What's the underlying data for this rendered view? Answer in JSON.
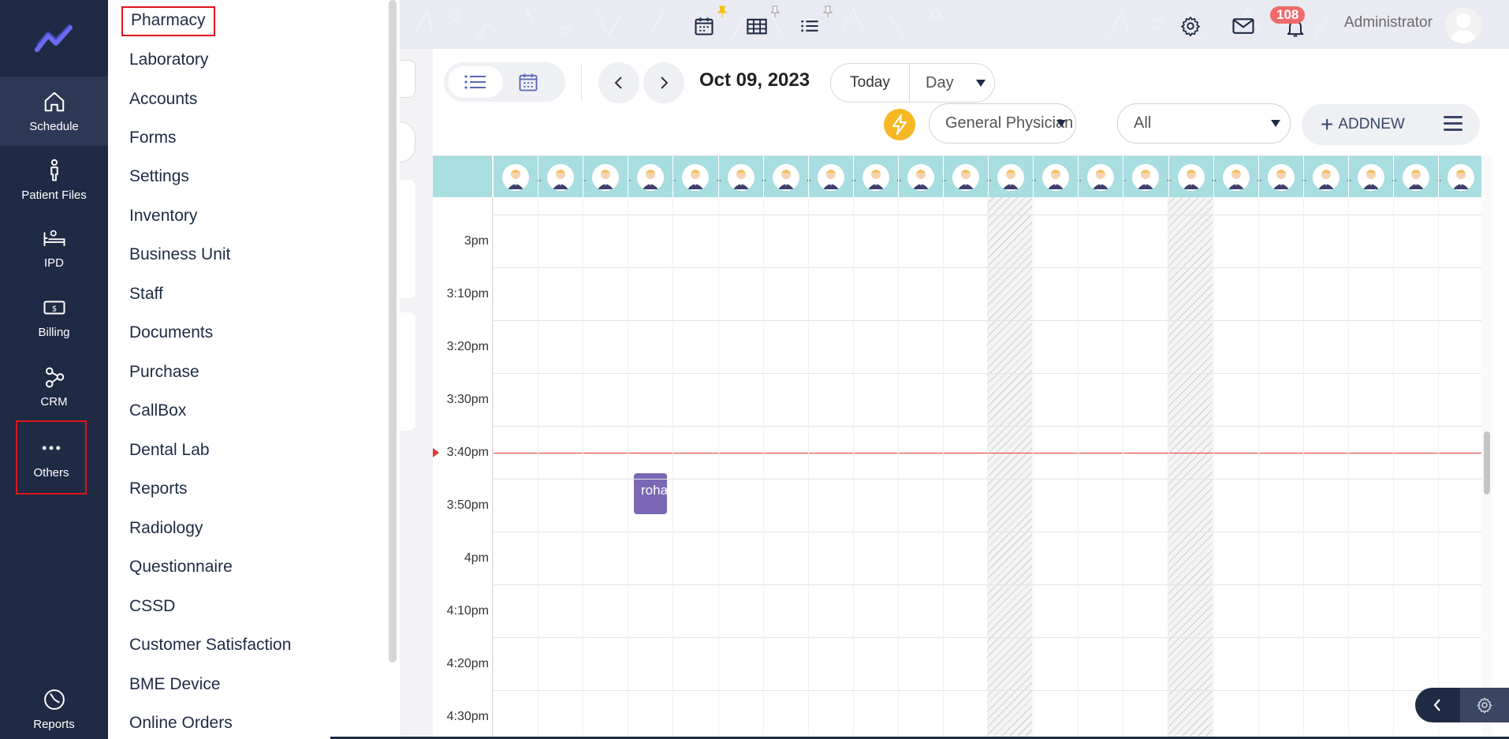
{
  "rail": {
    "items": [
      {
        "label": "Schedule",
        "icon": "home-icon"
      },
      {
        "label": "Patient Files",
        "icon": "person-icon"
      },
      {
        "label": "IPD",
        "icon": "bed-icon"
      },
      {
        "label": "Billing",
        "icon": "money-icon"
      },
      {
        "label": "CRM",
        "icon": "share-nodes-icon"
      },
      {
        "label": "Others",
        "icon": "more-dots-icon"
      },
      {
        "label": "Reports",
        "icon": "pie-chart-icon"
      }
    ]
  },
  "menu": {
    "items": [
      "Pharmacy",
      "Laboratory",
      "Accounts",
      "Forms",
      "Settings",
      "Inventory",
      "Business Unit",
      "Staff",
      "Documents",
      "Purchase",
      "CallBox",
      "Dental Lab",
      "Reports",
      "Radiology",
      "Questionnaire",
      "CSSD",
      "Customer Satisfaction",
      "BME Device",
      "Online Orders"
    ]
  },
  "topbar": {
    "notification_count": "108",
    "user_name": "Administrator"
  },
  "toolbar": {
    "date": "Oct 09, 2023",
    "today_label": "Today",
    "view_mode": "Day",
    "specialty": "General Physician",
    "filter": "All",
    "add_new_label": "ADDNEW"
  },
  "calendar": {
    "time_slots": [
      "3pm",
      "3:10pm",
      "3:20pm",
      "3:30pm",
      "3:40pm",
      "3:50pm",
      "4pm",
      "4:10pm",
      "4:20pm",
      "4:30pm"
    ],
    "doctor_column_count": 22,
    "appointment": {
      "text": "rohan"
    }
  },
  "colors": {
    "rail_bg": "#1f2a44",
    "accent_header": "#a8dde1",
    "appointment": "#7a68b5",
    "now_line": "#e53935",
    "highlight_box": "#e0141c"
  }
}
